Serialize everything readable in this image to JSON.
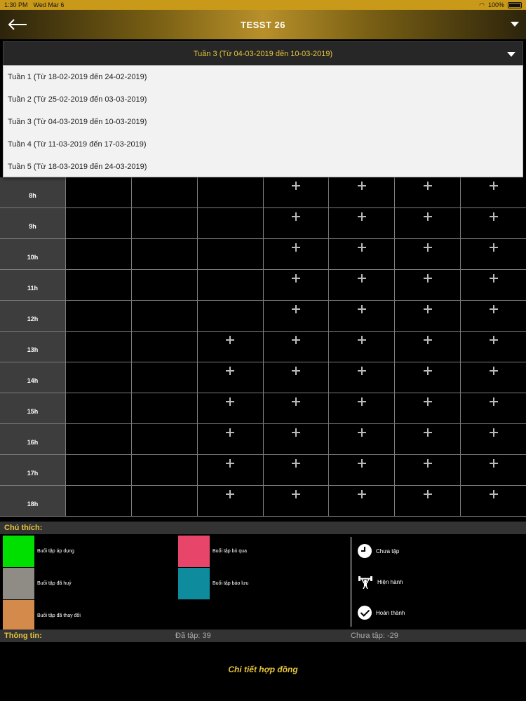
{
  "status_bar": {
    "time": "1:30 PM",
    "date": "Wed Mar 6",
    "battery": "100%"
  },
  "header": {
    "title": "TESST 26",
    "back_icon": "arrow-left-icon",
    "menu_icon": "caret-down-icon"
  },
  "week_selector": {
    "selected": "Tuần 3 (Từ 04-03-2019 đến 10-03-2019)",
    "options": [
      "Tuần 1 (Từ 18-02-2019 đến 24-02-2019)",
      "Tuần 2 (Từ 25-02-2019 đến 03-03-2019)",
      "Tuần 3 (Từ 04-03-2019 đến 10-03-2019)",
      "Tuần 4 (Từ 11-03-2019 đến 17-03-2019)",
      "Tuần 5 (Từ 18-03-2019 đến 24-03-2019)"
    ]
  },
  "schedule": {
    "rows": [
      {
        "hour": "8h",
        "add_from_col": 3
      },
      {
        "hour": "9h",
        "add_from_col": 3
      },
      {
        "hour": "10h",
        "add_from_col": 3
      },
      {
        "hour": "11h",
        "add_from_col": 3
      },
      {
        "hour": "12h",
        "add_from_col": 3
      },
      {
        "hour": "13h",
        "add_from_col": 2
      },
      {
        "hour": "14h",
        "add_from_col": 2
      },
      {
        "hour": "15h",
        "add_from_col": 2
      },
      {
        "hour": "16h",
        "add_from_col": 2
      },
      {
        "hour": "17h",
        "add_from_col": 2
      },
      {
        "hour": "18h",
        "add_from_col": 2
      }
    ],
    "day_columns": 7
  },
  "legend": {
    "title": "Chú thích:",
    "items": [
      {
        "label": "Buổi tập áp dụng",
        "color": "#00e000"
      },
      {
        "label": "Buổi tập đã huỷ",
        "color": "#8f8c86"
      },
      {
        "label": "Buổi tập đã thay đổi",
        "color": "#d48a4a"
      },
      {
        "label": "Buổi tập bỏ qua",
        "color": "#e8456a"
      },
      {
        "label": "Buổi tập bảo lưu",
        "color": "#0e8c9e"
      }
    ],
    "statuses": [
      {
        "label": "Chưa tập",
        "icon": "clock-icon"
      },
      {
        "label": "Hiện hành",
        "icon": "weightlifter-icon"
      },
      {
        "label": "Hoàn thành",
        "icon": "checkmark-icon"
      }
    ]
  },
  "info": {
    "title": "Thông tin:",
    "done": "Đã tập: 39",
    "pending": "Chưa tập: -29"
  },
  "contract_link": "Chi tiết hợp đồng"
}
